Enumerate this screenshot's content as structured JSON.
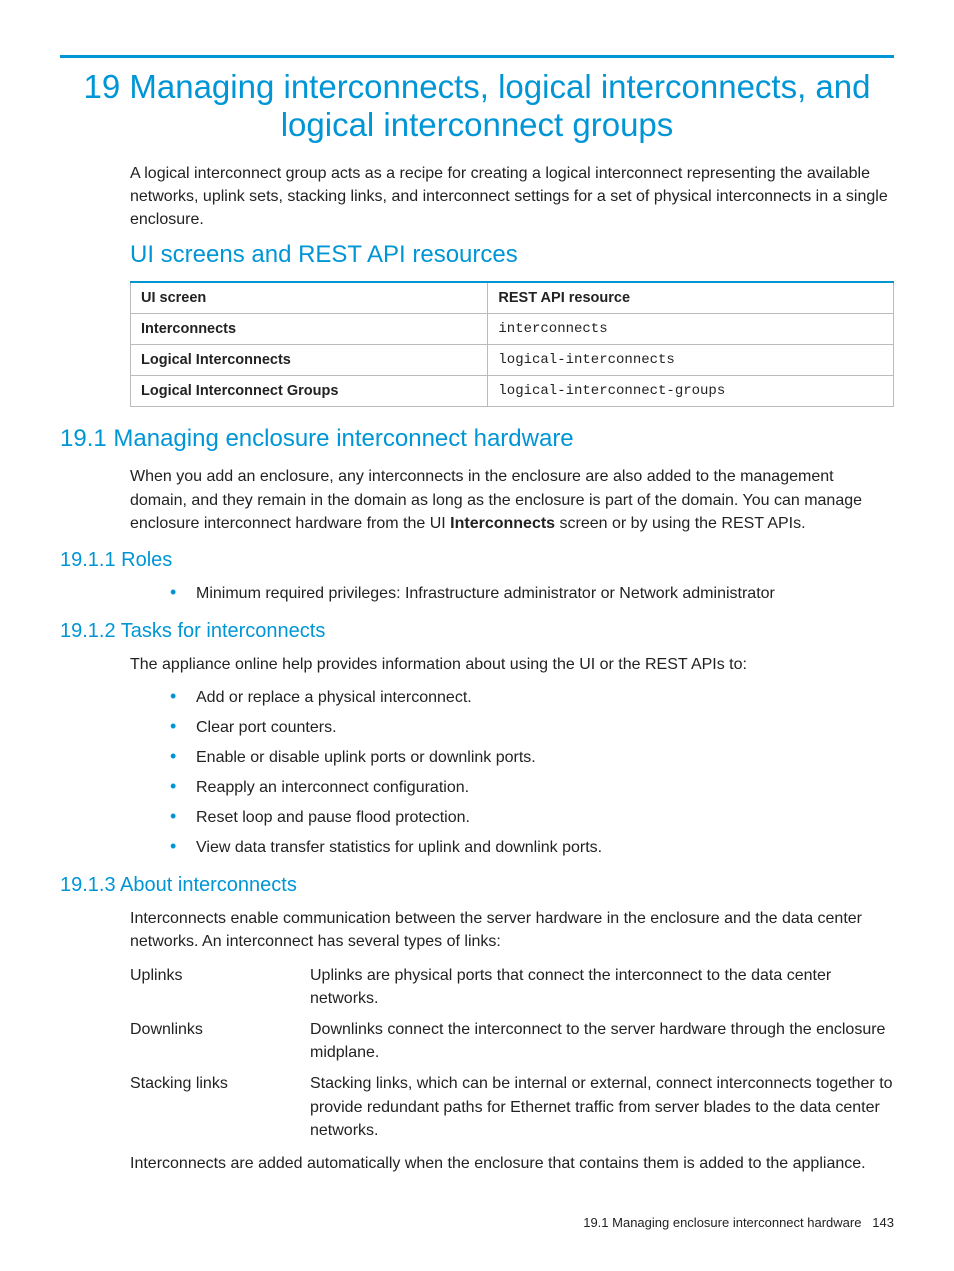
{
  "chapter_title": "19 Managing interconnects, logical interconnects, and logical interconnect groups",
  "intro": "A logical interconnect group acts as a recipe for creating a logical interconnect representing the available networks, uplink sets, stacking links, and interconnect settings for a set of physical interconnects in a single enclosure.",
  "section_ui_rest": {
    "heading": "UI screens and REST API resources",
    "th1": "UI screen",
    "th2": "REST API resource",
    "rows": [
      {
        "ui": "Interconnects",
        "api": "interconnects"
      },
      {
        "ui": "Logical Interconnects",
        "api": "logical-interconnects"
      },
      {
        "ui": "Logical Interconnect Groups",
        "api": "logical-interconnect-groups"
      }
    ]
  },
  "s191": {
    "heading": "19.1 Managing enclosure interconnect hardware",
    "p_before": "When you add an enclosure, any interconnects in the enclosure are also added to the management domain, and they remain in the domain as long as the enclosure is part of the domain. You can manage enclosure interconnect hardware from the UI ",
    "p_bold": "Interconnects",
    "p_after": " screen or by using the REST APIs."
  },
  "s1911": {
    "heading": "19.1.1 Roles",
    "items": [
      "Minimum required privileges: Infrastructure administrator or Network administrator"
    ]
  },
  "s1912": {
    "heading": "19.1.2 Tasks for interconnects",
    "intro": "The appliance online help provides information about using the UI or the REST APIs to:",
    "items": [
      "Add or replace a physical interconnect.",
      "Clear port counters.",
      "Enable or disable uplink ports or downlink ports.",
      "Reapply an interconnect configuration.",
      "Reset loop and pause flood protection.",
      "View data transfer statistics for uplink and downlink ports."
    ]
  },
  "s1913": {
    "heading": "19.1.3 About interconnects",
    "intro": "Interconnects enable communication between the server hardware in the enclosure and the data center networks. An interconnect has several types of links:",
    "defs": [
      {
        "term": "Uplinks",
        "desc": "Uplinks are physical ports that connect the interconnect to the data center networks."
      },
      {
        "term": "Downlinks",
        "desc": "Downlinks connect the interconnect to the server hardware through the enclosure midplane."
      },
      {
        "term": "Stacking links",
        "desc": "Stacking links, which can be internal or external, connect interconnects together to provide redundant paths for Ethernet traffic from server blades to the data center networks."
      }
    ],
    "outro": "Interconnects are added automatically when the enclosure that contains them is added to the appliance."
  },
  "footer": {
    "text": "19.1 Managing enclosure interconnect hardware",
    "page": "143"
  }
}
